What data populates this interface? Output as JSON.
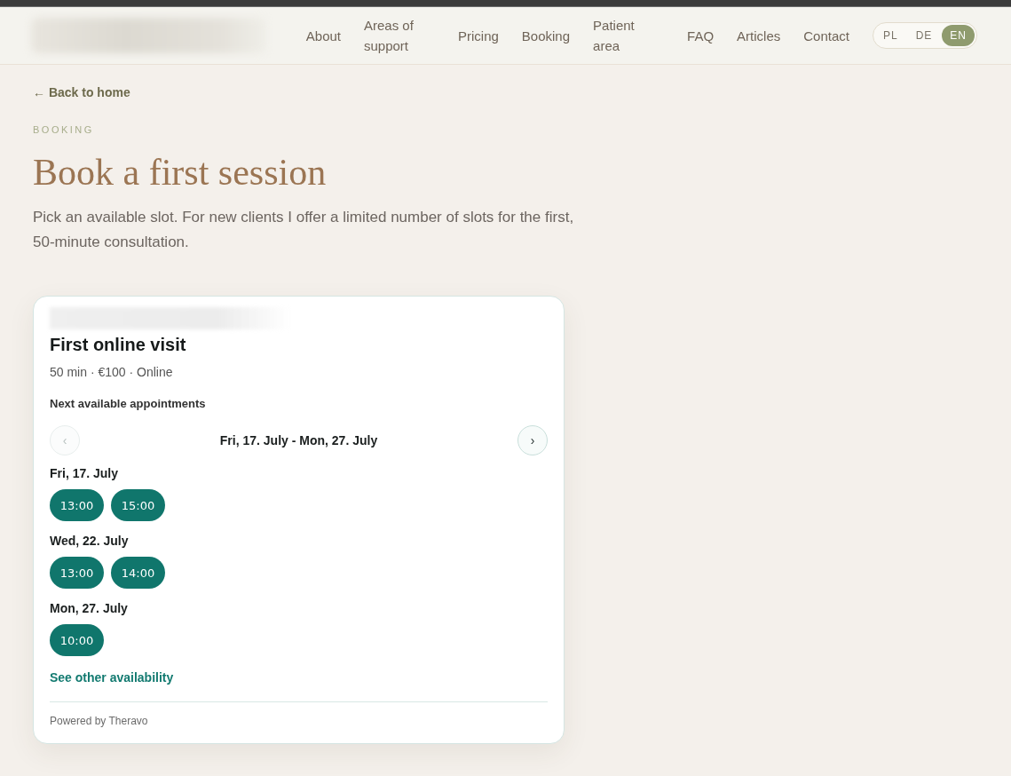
{
  "nav": {
    "items": [
      {
        "label": "About"
      },
      {
        "label": "Areas of support"
      },
      {
        "label": "Pricing"
      },
      {
        "label": "Booking"
      },
      {
        "label": "Patient area"
      },
      {
        "label": "FAQ"
      },
      {
        "label": "Articles"
      },
      {
        "label": "Contact"
      }
    ],
    "languages": [
      {
        "label": "PL",
        "selected": false
      },
      {
        "label": "DE",
        "selected": false
      },
      {
        "label": "EN",
        "selected": true
      }
    ]
  },
  "back_link": "← Back to home",
  "eyebrow": "BOOKING",
  "title": "Book a first session",
  "intro": "Pick an available slot. For new clients I offer a limited number of slots for the first, 50-minute consultation.",
  "booking_card": {
    "title": "First online visit",
    "meta": "50 min · €100 · Online",
    "section_label": "Next available appointments",
    "range": {
      "prev": {
        "symbol": "‹",
        "disabled": true
      },
      "label": "Fri, 17. July - Mon, 27. July",
      "next": {
        "symbol": "›",
        "disabled": false
      }
    },
    "days": [
      {
        "label": "Fri, 17. July",
        "slots": [
          "13:00",
          "15:00"
        ]
      },
      {
        "label": "Wed, 22. July",
        "slots": [
          "13:00",
          "14:00"
        ]
      },
      {
        "label": "Mon, 27. July",
        "slots": [
          "10:00"
        ]
      }
    ],
    "more_link": "See other availability",
    "footer": "Powered by Theravo"
  }
}
